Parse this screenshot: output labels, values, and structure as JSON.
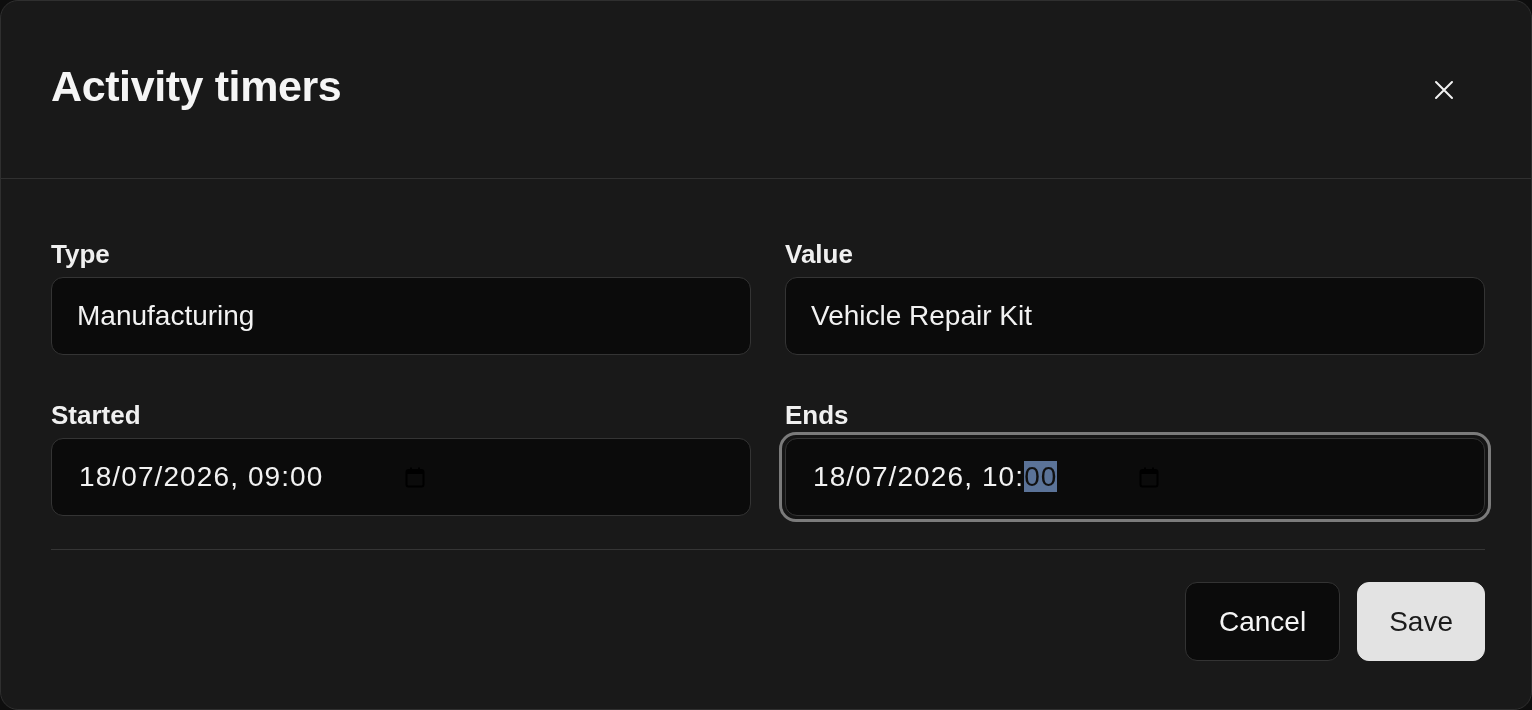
{
  "dialog": {
    "title": "Activity timers"
  },
  "fields": [
    {
      "label": "Type",
      "kind": "text",
      "value": "Manufacturing",
      "focused": false
    },
    {
      "label": "Value",
      "kind": "text",
      "value": "Vehicle Repair Kit",
      "focused": false
    },
    {
      "label": "Started",
      "kind": "datetime",
      "segments": [
        {
          "text": "18/07/2026, 09:00",
          "selected": false
        }
      ],
      "focused": false
    },
    {
      "label": "Ends",
      "kind": "datetime",
      "segments": [
        {
          "text": "18/07/2026, 10:",
          "selected": false
        },
        {
          "text": "00",
          "selected": true
        }
      ],
      "focused": true
    }
  ],
  "buttons": [
    {
      "label": "Cancel",
      "kind": "secondary"
    },
    {
      "label": "Save",
      "kind": "primary"
    }
  ]
}
